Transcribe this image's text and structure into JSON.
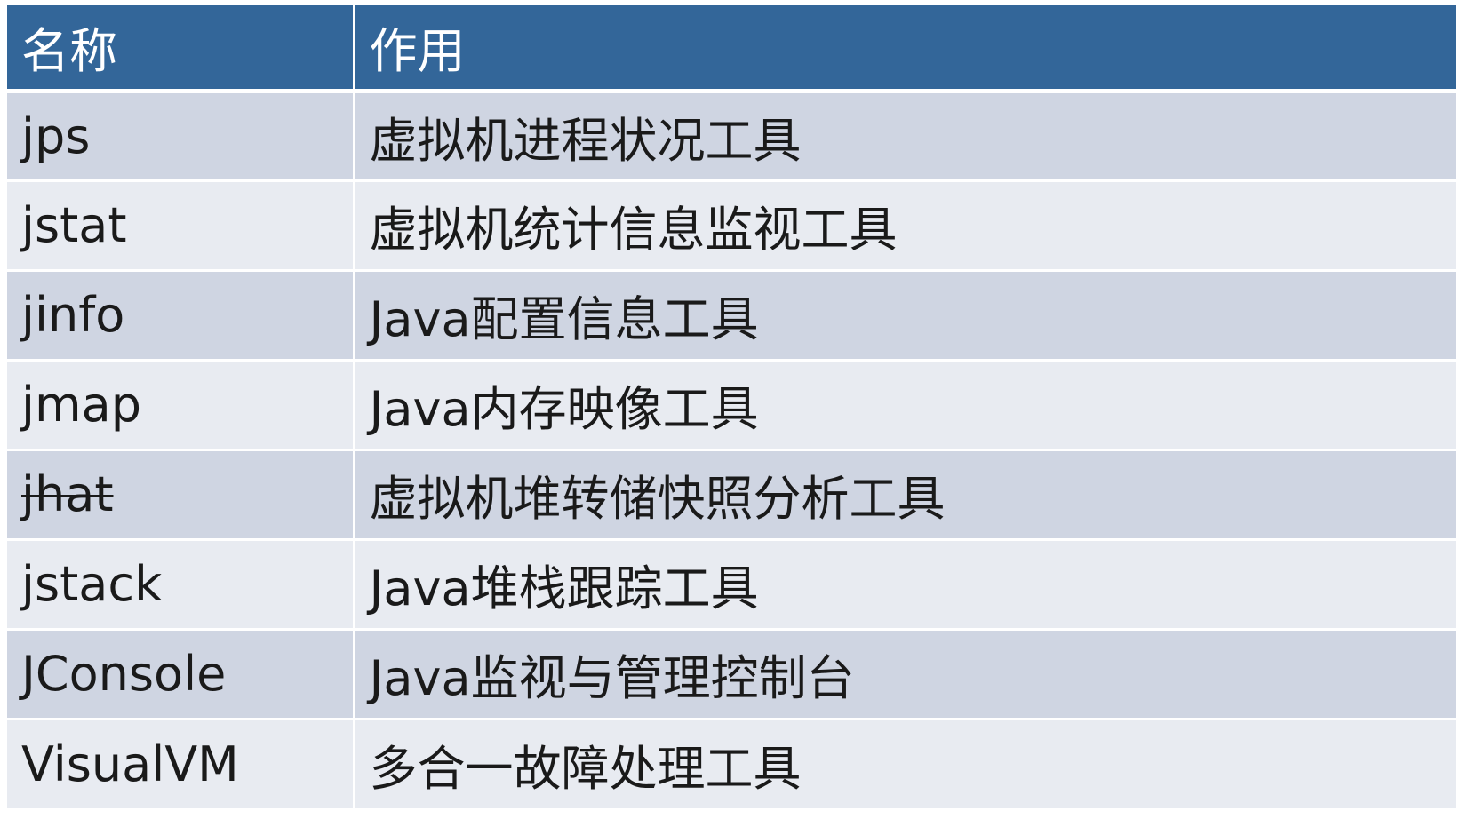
{
  "table": {
    "headers": {
      "name": "名称",
      "purpose": "作用"
    },
    "rows": [
      {
        "name": "jps",
        "purpose": "虚拟机进程状况工具",
        "struck": false
      },
      {
        "name": "jstat",
        "purpose": "虚拟机统计信息监视工具",
        "struck": false
      },
      {
        "name": "jinfo",
        "purpose": "Java配置信息工具",
        "struck": false
      },
      {
        "name": "jmap",
        "purpose": "Java内存映像工具",
        "struck": false
      },
      {
        "name": "jhat",
        "purpose": "虚拟机堆转储快照分析工具",
        "struck": true
      },
      {
        "name": "jstack",
        "purpose": "Java堆栈跟踪工具",
        "struck": false
      },
      {
        "name": "JConsole",
        "purpose": "Java监视与管理控制台",
        "struck": false
      },
      {
        "name": "VisualVM",
        "purpose": "多合一故障处理工具",
        "struck": false
      }
    ],
    "colors": {
      "header_bg": "#336699",
      "header_text": "#ffffff",
      "row_odd_bg": "#cfd5e2",
      "row_even_bg": "#e8ebf1"
    }
  }
}
